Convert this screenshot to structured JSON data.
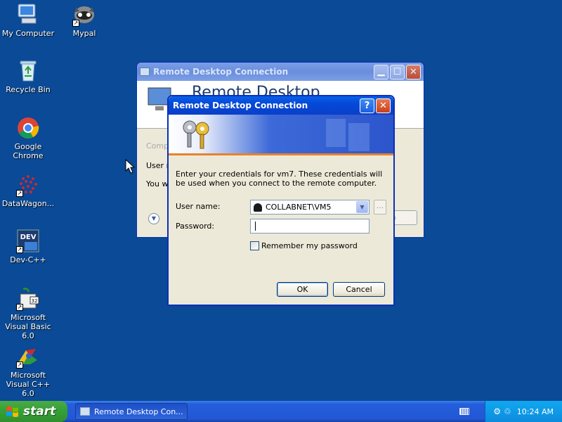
{
  "desktop": {
    "icons": [
      {
        "label": "My Computer"
      },
      {
        "label": "Mypal"
      },
      {
        "label": "Recycle Bin"
      },
      {
        "label": "Google Chrome"
      },
      {
        "label": "DataWagon..."
      },
      {
        "label": "Dev-C++"
      },
      {
        "label": "Microsoft Visual Basic 6.0"
      },
      {
        "label": "Microsoft Visual C++ 6.0"
      }
    ]
  },
  "rdc_window": {
    "title": "Remote Desktop Connection",
    "banner_text": "Remote Desktop",
    "frag_computer": "Comp",
    "frag_user": "User n",
    "frag_you": "You w"
  },
  "cred_dialog": {
    "title": "Remote Desktop Connection",
    "help_glyph": "?",
    "close_glyph": "✕",
    "message": "Enter your credentials for vm7. These credentials will be used when you connect to the remote computer.",
    "username_label": "User name:",
    "username_value": "COLLABNET\\VM5",
    "browse_label": "...",
    "password_label": "Password:",
    "password_value": "",
    "remember_label": "Remember my password",
    "ok_label": "OK",
    "cancel_label": "Cancel"
  },
  "taskbar": {
    "start_label": "start",
    "task_label": "Remote Desktop Con...",
    "clock": "10:24 AM"
  }
}
